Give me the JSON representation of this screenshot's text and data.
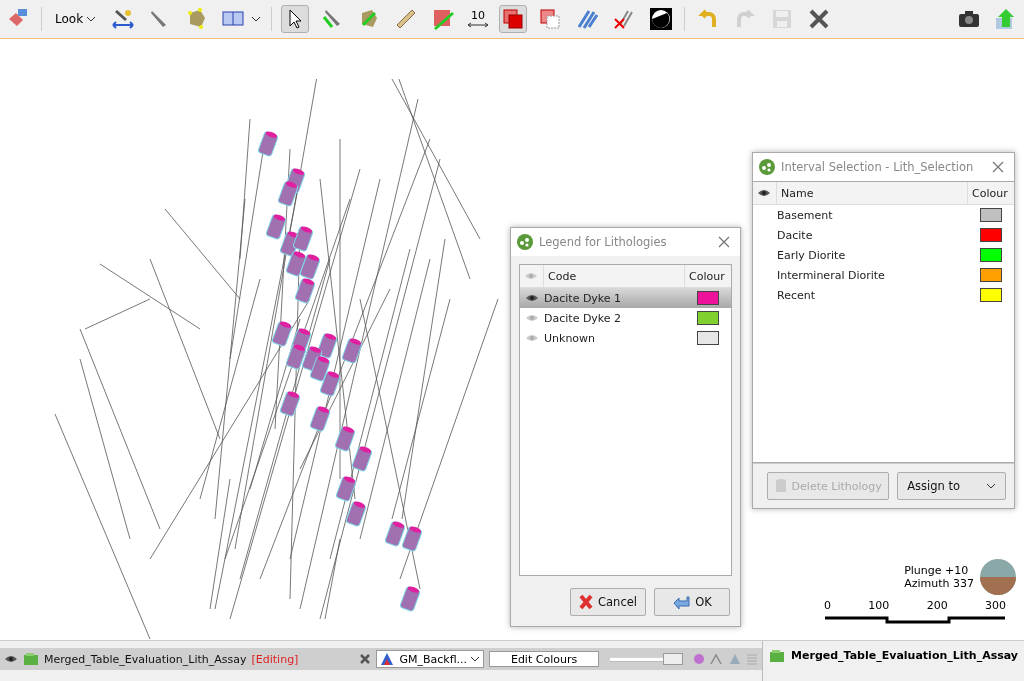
{
  "toolbar": [
    {
      "kind": "tool",
      "selected": false,
      "disabled": false
    },
    {
      "kind": "separator"
    },
    {
      "kind": "menu",
      "label": "Look"
    },
    {
      "kind": "tool",
      "selected": false,
      "disabled": false
    },
    {
      "kind": "tool",
      "selected": false,
      "disabled": false
    },
    {
      "kind": "tool",
      "selected": false,
      "disabled": false
    },
    {
      "kind": "split",
      "selected": false,
      "disabled": false
    },
    {
      "kind": "separator"
    },
    {
      "kind": "tool",
      "selected": true,
      "disabled": false
    },
    {
      "kind": "tool",
      "selected": false,
      "disabled": false
    },
    {
      "kind": "tool",
      "selected": false,
      "disabled": false
    },
    {
      "kind": "tool",
      "selected": false,
      "disabled": false
    },
    {
      "kind": "tool",
      "selected": false,
      "disabled": false
    },
    {
      "kind": "width",
      "label": "10"
    },
    {
      "kind": "tool",
      "selected": true,
      "disabled": false
    },
    {
      "kind": "tool",
      "selected": false,
      "disabled": false
    },
    {
      "kind": "tool",
      "selected": false,
      "disabled": false
    },
    {
      "kind": "tool",
      "selected": false,
      "disabled": false
    },
    {
      "kind": "tool",
      "selected": false,
      "disabled": false
    },
    {
      "kind": "separator"
    },
    {
      "kind": "tool",
      "selected": false,
      "disabled": false
    },
    {
      "kind": "tool",
      "selected": false,
      "disabled": true
    },
    {
      "kind": "tool",
      "selected": false,
      "disabled": true
    },
    {
      "kind": "tool",
      "selected": false,
      "disabled": false
    },
    {
      "kind": "spacer"
    },
    {
      "kind": "tool",
      "selected": false,
      "disabled": false
    },
    {
      "kind": "tool",
      "selected": false,
      "disabled": false
    }
  ],
  "legend_dialog": {
    "title": "Legend for Lithologies",
    "columns": [
      "Code",
      "Colour"
    ],
    "rows": [
      {
        "code": "Dacite Dyke 1",
        "color": "#ee1199",
        "visible": true,
        "selected": true
      },
      {
        "code": "Dacite Dyke 2",
        "color": "#80d030",
        "visible": false,
        "selected": false
      },
      {
        "code": "Unknown",
        "color": "#e6e6e6",
        "visible": false,
        "selected": false
      }
    ],
    "buttons": [
      "Cancel",
      "OK"
    ]
  },
  "interval_dialog": {
    "title": "Interval Selection - Lith_Selection",
    "columns": [
      "Name",
      "Colour"
    ],
    "rows": [
      {
        "name": "Basement",
        "color": "#c0c0c0"
      },
      {
        "name": "Dacite",
        "color": "#ff0000"
      },
      {
        "name": "Early Diorite",
        "color": "#00ff00"
      },
      {
        "name": "Intermineral Diorite",
        "color": "#ffa000"
      },
      {
        "name": "Recent",
        "color": "#ffff00"
      }
    ],
    "delete_button": {
      "label": "Delete Lithology",
      "disabled": true
    },
    "assign_button": {
      "label": "Assign to"
    }
  },
  "view_info": {
    "plunge": "Plunge +10",
    "azimuth": "Azimuth 337",
    "scale_labels": [
      "0",
      "100",
      "200",
      "300"
    ]
  },
  "status_bar": {
    "object": "Merged_Table_Evaluation_Lith_Assay",
    "state": "[Editing]",
    "colormap": "GM_Backfl...",
    "edit_button": "Edit Colours",
    "opacity": {
      "level": 0.88
    }
  },
  "side_panel": {
    "title": "Merged_Table_Evaluation_Lith_Assay"
  }
}
